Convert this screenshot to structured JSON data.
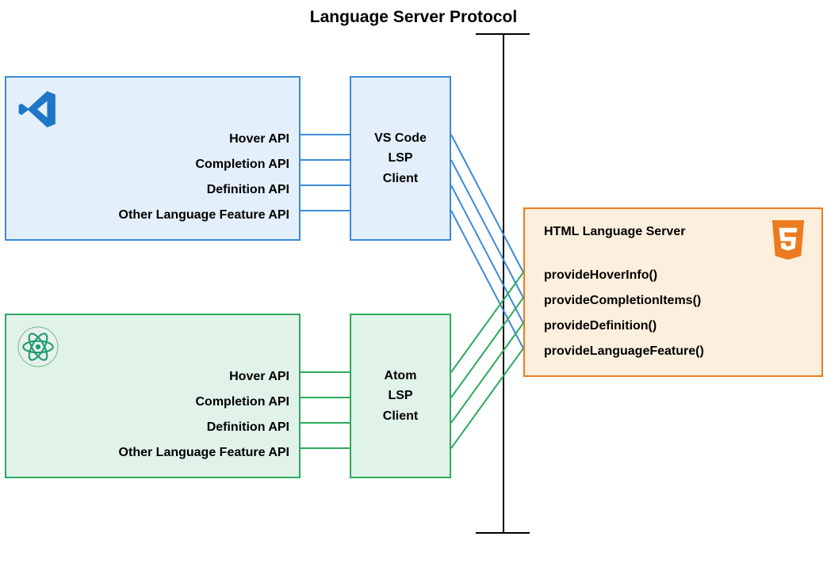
{
  "title": "Language Server Protocol",
  "editors": {
    "vscode": {
      "name": "VS Code",
      "apis": [
        "Hover API",
        "Completion API",
        "Definition API",
        "Other Language Feature API"
      ],
      "client_label_1": "VS Code",
      "client_label_2": "LSP",
      "client_label_3": "Client",
      "color": "#3c8ad6",
      "bg": "#e3effa"
    },
    "atom": {
      "name": "Atom",
      "apis": [
        "Hover API",
        "Completion API",
        "Definition API",
        "Other Language Feature API"
      ],
      "client_label_1": "Atom",
      "client_label_2": "LSP",
      "client_label_3": "Client",
      "color": "#2daa5e",
      "bg": "#e1f3e9"
    }
  },
  "server": {
    "title": "HTML Language Server",
    "methods": [
      "provideHoverInfo()",
      "provideCompletionItems()",
      "provideDefinition()",
      "provideLanguageFeature()"
    ],
    "color": "#ec7b1f",
    "bg": "#fdefdd"
  }
}
